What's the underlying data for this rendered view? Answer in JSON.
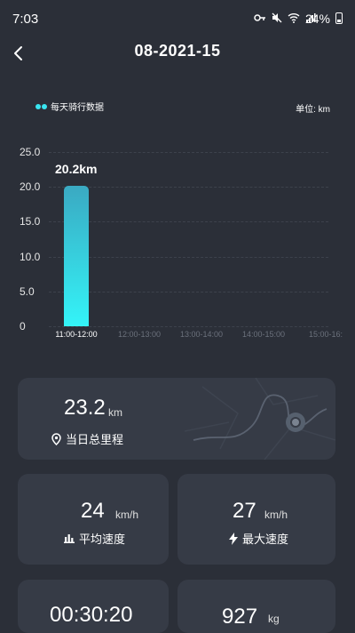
{
  "status_bar": {
    "time": "7:03",
    "battery_percent": "24%"
  },
  "header": {
    "title": "08-2021-15"
  },
  "chart": {
    "legend_label": "每天骑行数据",
    "unit_label": "单位: km"
  },
  "chart_data": {
    "type": "bar",
    "categories": [
      "11:00-12:00",
      "12:00-13:00",
      "13:00-14:00",
      "14:00-15:00",
      "15:00-16:"
    ],
    "values": [
      20.2,
      0,
      0,
      0,
      0
    ],
    "data_labels": [
      "20.2km",
      "",
      "",
      "",
      ""
    ],
    "y_ticks": [
      "25.0",
      "20.0",
      "15.0",
      "10.0",
      "5.0",
      "0"
    ],
    "ylim": [
      0,
      25
    ],
    "bar_color": "#34f4f8",
    "grid": true
  },
  "stats": {
    "total": {
      "value": "23.2",
      "unit": "km",
      "label": "当日总里程"
    },
    "avg_speed": {
      "value": "24",
      "unit": "km/h",
      "label": "平均速度"
    },
    "max_speed": {
      "value": "27",
      "unit": "km/h",
      "label": "最大速度"
    },
    "duration": {
      "value": "00:30:20"
    },
    "calories": {
      "value": "927",
      "unit": "kg"
    }
  },
  "icons": {
    "back": "chevron-left-icon",
    "location": "location-pin-icon",
    "avg": "bar-chart-icon",
    "max": "lightning-icon"
  },
  "colors": {
    "background": "#2b2f38",
    "card": "#363b46",
    "accent": "#34f4f8"
  }
}
